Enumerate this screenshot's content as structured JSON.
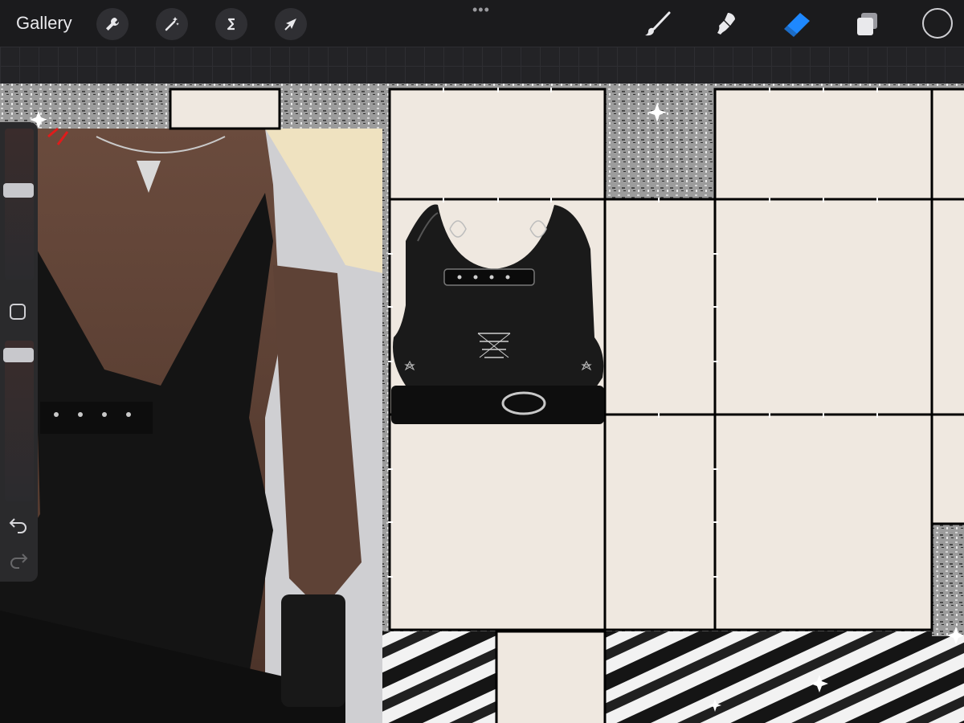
{
  "toolbar": {
    "gallery_label": "Gallery",
    "left_tools": [
      "wrench-icon",
      "magic-wand-icon",
      "selection-s-icon",
      "transform-arrow-icon"
    ],
    "more_glyph": "•••",
    "right_tools": [
      "brush-icon",
      "smudge-icon",
      "eraser-icon",
      "layers-icon"
    ],
    "active_tool": "eraser-icon",
    "accent_color": "#1e88ff",
    "current_color": "#1c1c1e"
  },
  "sidebar": {
    "brush_size_level": 0.6,
    "opacity_level": 0.95,
    "modify_icon": "square-modify-icon",
    "undo_icon": "undo-icon",
    "redo_icon": "redo-icon"
  },
  "canvas": {
    "panel_color": "#efe8e0",
    "border_color": "#000000",
    "photo_subject": "photo-collage",
    "top_item": "black-corset-top-cutout"
  }
}
